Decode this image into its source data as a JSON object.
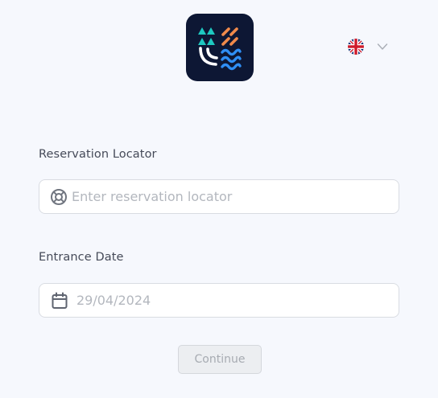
{
  "header": {
    "logo_icon": "app-logo-icon",
    "language": {
      "flag_icon": "uk-flag-icon",
      "chevron_icon": "chevron-down-icon"
    }
  },
  "form": {
    "reservation": {
      "label": "Reservation Locator",
      "placeholder": "Enter reservation locator",
      "value": "",
      "icon": "lifebuoy-icon"
    },
    "entrance_date": {
      "label": "Entrance Date",
      "value": "29/04/2024",
      "icon": "calendar-icon"
    },
    "continue_label": "Continue"
  },
  "colors": {
    "background": "#f6f8fd",
    "logo_background": "#0d1734",
    "logo_teal": "#1ec8c0",
    "logo_orange": "#f08a4b",
    "logo_blue": "#2f8ff5",
    "button_disabled": "#eceef1"
  }
}
